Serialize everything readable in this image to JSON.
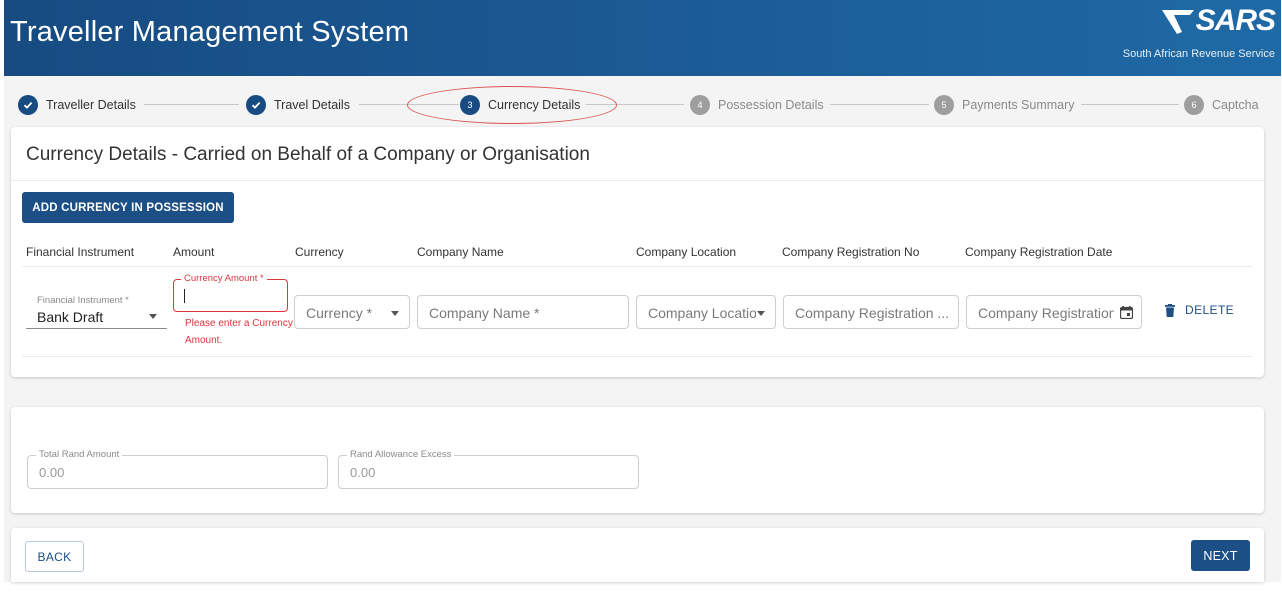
{
  "header": {
    "title": "Traveller Management System",
    "logo_text": "SARS",
    "logo_subtitle": "South African Revenue Service"
  },
  "stepper": {
    "steps": [
      {
        "number": "1",
        "label": "Traveller Details",
        "state": "done"
      },
      {
        "number": "2",
        "label": "Travel Details",
        "state": "done"
      },
      {
        "number": "3",
        "label": "Currency Details",
        "state": "active"
      },
      {
        "number": "4",
        "label": "Possession Details",
        "state": "todo"
      },
      {
        "number": "5",
        "label": "Payments Summary",
        "state": "todo"
      },
      {
        "number": "6",
        "label": "Captcha",
        "state": "todo"
      }
    ]
  },
  "currency_card": {
    "title": "Currency Details - Carried on Behalf of a Company or Organisation",
    "add_button": "ADD CURRENCY IN POSSESSION",
    "columns": [
      "Financial Instrument",
      "Amount",
      "Currency",
      "Company Name",
      "Company Location",
      "Company Registration No",
      "Company Registration Date"
    ],
    "row": {
      "financial_instrument_label": "Financial Instrument *",
      "financial_instrument_value": "Bank Draft",
      "amount_label": "Currency Amount *",
      "amount_value": "",
      "amount_error": "Please enter a Currency Amount.",
      "currency_placeholder": "Currency *",
      "company_name_placeholder": "Company Name *",
      "company_location_placeholder": "Company Location",
      "company_reg_no_placeholder": "Company Registration ...",
      "company_reg_date_placeholder": "Company Registration",
      "delete_label": "DELETE"
    }
  },
  "totals_card": {
    "total_rand_label": "Total Rand Amount",
    "total_rand_value": "0.00",
    "rand_excess_label": "Rand Allowance Excess",
    "rand_excess_value": "0.00"
  },
  "nav": {
    "back_label": "BACK",
    "next_label": "NEXT"
  },
  "colors": {
    "primary": "#1b4f86",
    "header_start": "#174b82",
    "header_end": "#1e6aa6",
    "error": "#d9363e",
    "highlight": "#d9534f"
  }
}
